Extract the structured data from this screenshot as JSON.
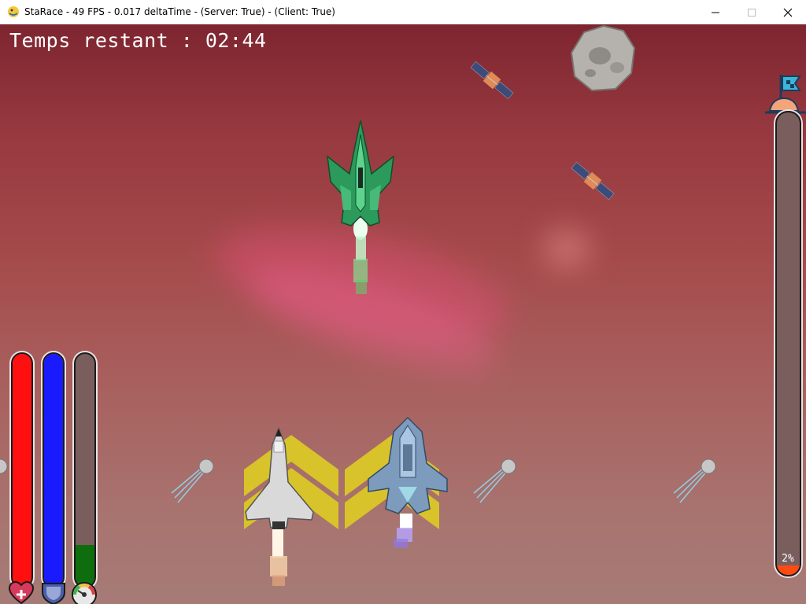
{
  "window": {
    "title": "StaRace - 49 FPS - 0.017 deltaTime - (Server: True) - (Client: True)",
    "app_icon": "pygame-snake-icon",
    "controls": [
      "minimize-icon",
      "maximize-icon",
      "close-icon"
    ]
  },
  "hud": {
    "timer_text": "Temps restant : 02:44",
    "stats": [
      {
        "name": "health",
        "icon": "heart-plus-icon",
        "color": "#ff1010",
        "level": 1.0
      },
      {
        "name": "shield",
        "icon": "shield-icon",
        "color": "#1a1aff",
        "level": 1.0
      },
      {
        "name": "speed",
        "icon": "speedometer-icon",
        "color": "#0e6e0e",
        "level": 0.18
      }
    ],
    "race_progress": {
      "icon": "finish-flag-icon",
      "color": "#ff4a12",
      "percent": 2,
      "label": "2%"
    }
  },
  "colors": {
    "sky_top": "#7e2530",
    "sky_bottom": "#a67b76",
    "boost_chevron": "#d8c32a"
  },
  "scene": {
    "ships": [
      "green-fighter-ship",
      "space-shuttle",
      "blue-fighter-ship"
    ],
    "obstacles": [
      "asteroid",
      "satellite",
      "satellite",
      "sputnik-probe",
      "sputnik-probe",
      "sputnik-probe",
      "sputnik-probe"
    ],
    "boost_pads": [
      "chevron-boost-pad",
      "chevron-boost-pad"
    ]
  }
}
